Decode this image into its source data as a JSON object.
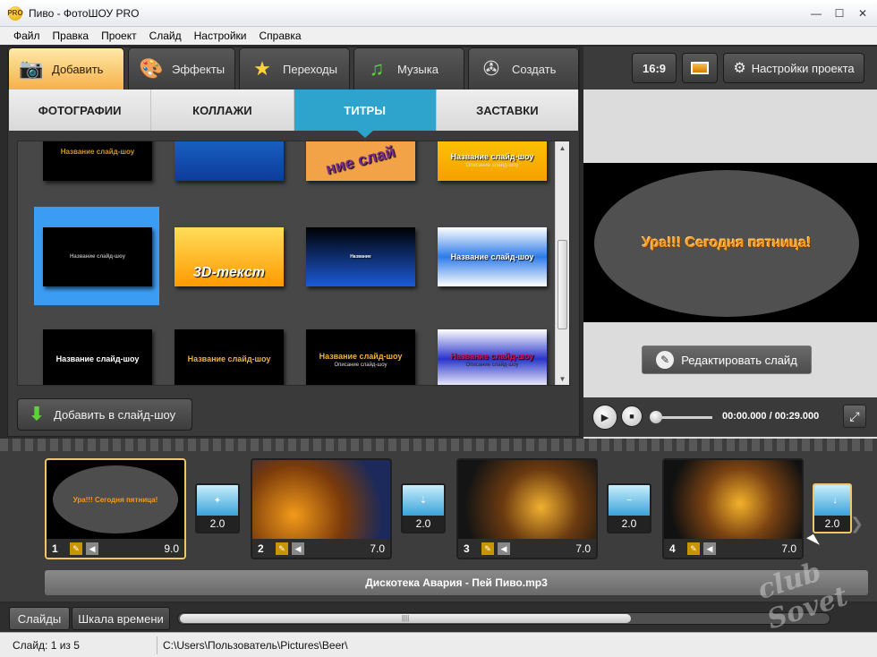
{
  "window": {
    "title": "Пиво - ФотоШОУ PRO",
    "app_icon_text": "PRO"
  },
  "menu": [
    "Файл",
    "Правка",
    "Проект",
    "Слайд",
    "Настройки",
    "Справка"
  ],
  "main_tabs": [
    {
      "label": "Добавить",
      "icon": "camera-icon",
      "active": true
    },
    {
      "label": "Эффекты",
      "icon": "palette-icon",
      "active": false
    },
    {
      "label": "Переходы",
      "icon": "star-icon",
      "active": false
    },
    {
      "label": "Музыка",
      "icon": "music-note-icon",
      "active": false
    },
    {
      "label": "Создать",
      "icon": "film-reel-icon",
      "active": false
    }
  ],
  "sub_tabs": [
    {
      "label": "ФОТОГРАФИИ",
      "active": false
    },
    {
      "label": "КОЛЛАЖИ",
      "active": false
    },
    {
      "label": "ТИТРЫ",
      "active": true
    },
    {
      "label": "ЗАСТАВКИ",
      "active": false
    }
  ],
  "gallery": {
    "row1": [
      {
        "t1": "Название слайд-шоу",
        "bg": "#000"
      },
      {
        "t1": "",
        "bg": "linear-gradient(#1e6fd0,#0d3c9a)"
      },
      {
        "t1": "ние слай",
        "bg": "#f3a347"
      },
      {
        "t1": "Название слайд-шоу",
        "t2": "Описание слайд-шоу",
        "bg": "linear-gradient(#ffd200,#f5a000)"
      }
    ],
    "row2": [
      {
        "t1": "Название слайд-шоу",
        "bg": "#000"
      },
      {
        "t1": "3D-текст",
        "bg": "linear-gradient(#ffde5a,#ff9a00)"
      },
      {
        "t1": "Название",
        "bg": "linear-gradient(#000,#1b5ad8)"
      },
      {
        "t1": "Название слайд-шоу",
        "bg": "linear-gradient(#fff,#2f7ce8,#fff)"
      }
    ],
    "row3": [
      {
        "t1": "Название слайд-шоу",
        "bg": "#000"
      },
      {
        "t1": "Название слайд-шоу",
        "bg": "#000"
      },
      {
        "t1": "Название слайд-шоу",
        "t2": "Описание слайд-шоу",
        "bg": "#000"
      },
      {
        "t1": "Название слайд-шоу",
        "t2": "Описание слайд-шоу",
        "bg": "linear-gradient(#fff,#2a35c9,#fff)"
      }
    ],
    "add_button": "Добавить в слайд-шоу"
  },
  "right": {
    "aspect_button": "16:9",
    "settings_button": "Настройки проекта",
    "preview_text": "Ура!!!  Сегодня пятница!",
    "edit_button": "Редактировать слайд",
    "time": "00:00.000 / 00:29.000"
  },
  "slides": [
    {
      "num": "1",
      "dur": "9.0",
      "active": true
    },
    {
      "num": "2",
      "dur": "7.0",
      "active": false
    },
    {
      "num": "3",
      "dur": "7.0",
      "active": false
    },
    {
      "num": "4",
      "dur": "7.0",
      "active": false
    }
  ],
  "transitions": [
    "2.0",
    "2.0",
    "2.0",
    "2.0"
  ],
  "slide1_text": "Ура!!!  Сегодня пятница!",
  "audio_track": "Дискотека Авария - Пей Пиво.mp3",
  "bottom_tabs": [
    {
      "label": "Слайды",
      "active": true
    },
    {
      "label": "Шкала времени",
      "active": false
    }
  ],
  "status": {
    "slide": "Слайд: 1 из 5",
    "path": "C:\\Users\\Пользователь\\Pictures\\Beer\\"
  },
  "watermark": "club Sovet"
}
